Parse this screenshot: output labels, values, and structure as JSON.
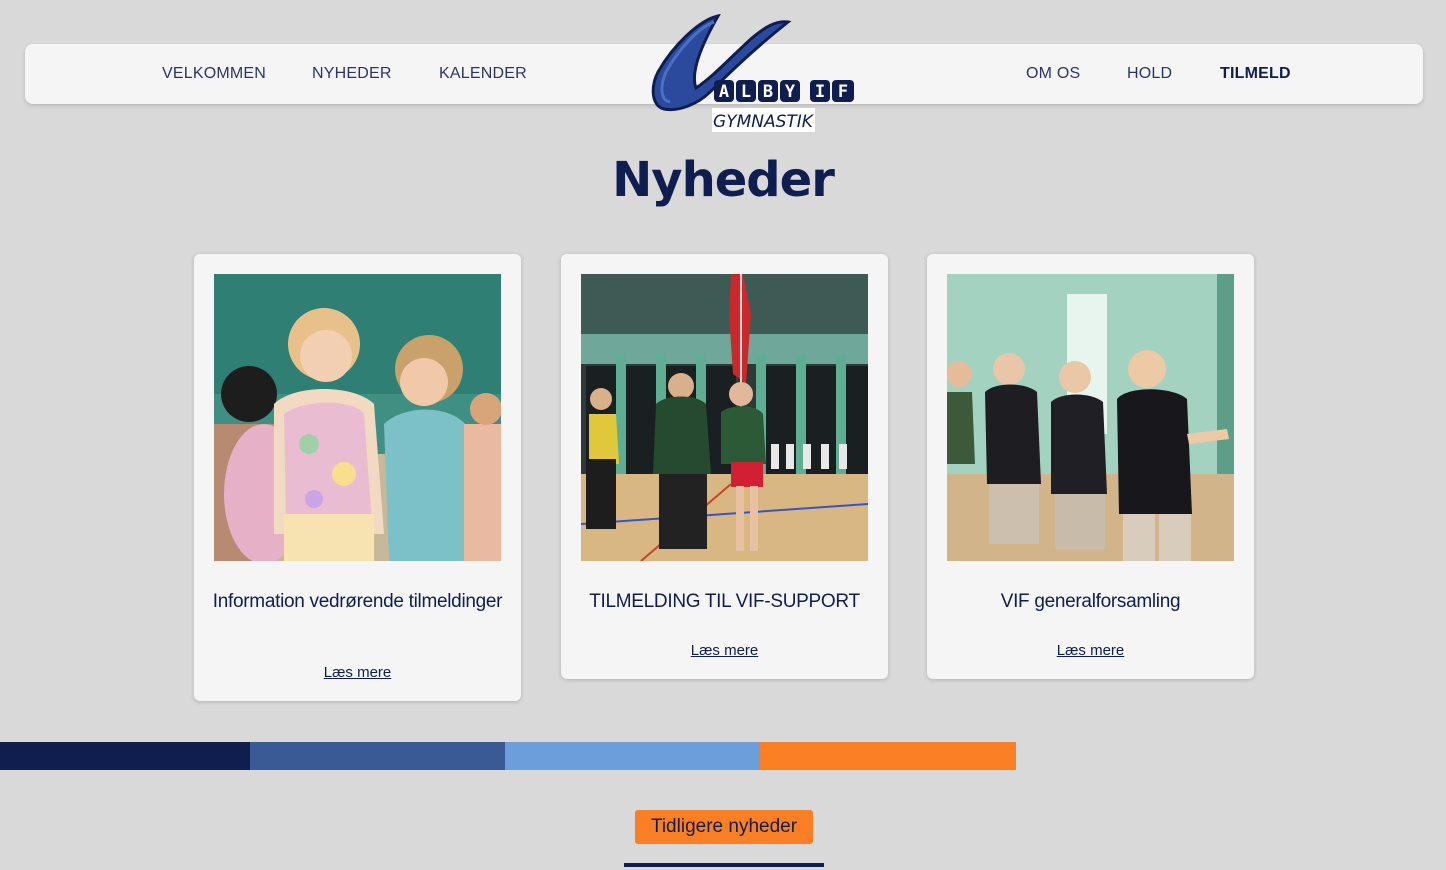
{
  "nav": {
    "left": [
      "VELKOMMEN",
      "NYHEDER",
      "KALENDER"
    ],
    "right": [
      "OM OS",
      "HOLD",
      "TILMELD"
    ]
  },
  "logo": {
    "letters": [
      "A",
      "L",
      "B",
      "Y",
      "I",
      "F"
    ],
    "subtitle": "GYMNASTIK"
  },
  "page_title": "Nyheder",
  "news": [
    {
      "title": "Information vedrørende tilmeldinger",
      "read_more": "Læs mere",
      "image": "children-dancing-photo"
    },
    {
      "title": "TILMELDING TIL VIF-SUPPORT",
      "read_more": "Læs mere",
      "image": "flag-bearers-photo"
    },
    {
      "title": "VIF generalforsamling",
      "read_more": "Læs mere",
      "image": "boys-marching-photo"
    }
  ],
  "colors": {
    "stripe": [
      "#0f1e4f",
      "#3a5a96",
      "#6b9edb",
      "#fb7f24"
    ],
    "accent": "#fb7f24",
    "navy": "#0f1e4f"
  },
  "older_button": "Tidligere nyheder"
}
